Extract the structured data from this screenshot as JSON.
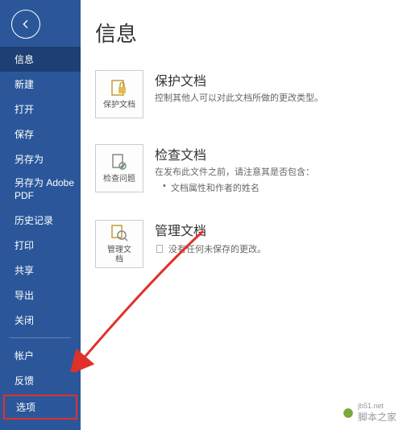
{
  "sidebar": {
    "items": [
      {
        "label": "信息",
        "selected": true
      },
      {
        "label": "新建"
      },
      {
        "label": "打开"
      },
      {
        "label": "保存"
      },
      {
        "label": "另存为"
      },
      {
        "label": "另存为 Adobe PDF"
      },
      {
        "label": "历史记录"
      },
      {
        "label": "打印"
      },
      {
        "label": "共享"
      },
      {
        "label": "导出"
      },
      {
        "label": "关闭"
      }
    ],
    "footer": [
      {
        "label": "帐户"
      },
      {
        "label": "反馈"
      },
      {
        "label": "选项",
        "highlighted": true
      }
    ]
  },
  "main": {
    "title": "信息",
    "sections": {
      "protect": {
        "tile_label": "保护文档",
        "title": "保护文档",
        "desc": "控制其他人可以对此文档所做的更改类型。"
      },
      "inspect": {
        "tile_label": "检查问题",
        "title": "检查文档",
        "desc": "在发布此文件之前，请注意其是否包含：",
        "bullet1": "文档属性和作者的姓名"
      },
      "manage": {
        "tile_label": "管理文\n档",
        "title": "管理文档",
        "desc": "没有任何未保存的更改。"
      }
    }
  },
  "watermark": {
    "text": "脚本之家",
    "url": "jb51.net"
  }
}
